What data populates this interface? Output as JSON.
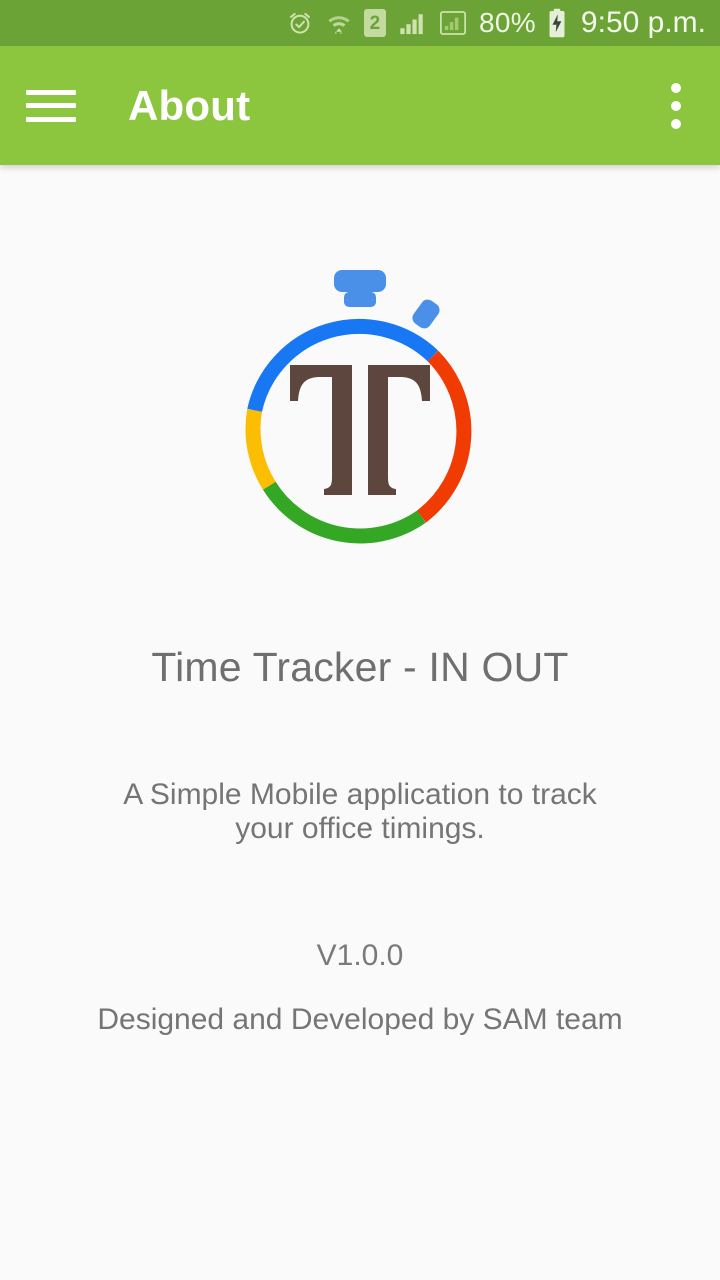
{
  "status_bar": {
    "background_color": "#6CA336",
    "icons": [
      {
        "name": "alarm-clock-icon",
        "label": "alarm"
      },
      {
        "name": "wifi-icon",
        "label": "wifi"
      },
      {
        "name": "sim-2-icon",
        "label": "2"
      },
      {
        "name": "signal-bars-icon",
        "label": "signal"
      },
      {
        "name": "signal-bars-secondary-icon",
        "label": "signal 2"
      },
      {
        "name": "battery-charging-icon",
        "label": "charging"
      }
    ],
    "battery_percent": "80%",
    "time": "9:50 p.m."
  },
  "app_bar": {
    "background_color": "#8CC63F",
    "menu_icon": "hamburger-menu-icon",
    "title": "About",
    "overflow_icon": "more-vertical-icon"
  },
  "logo": {
    "name": "stopwatch-logo",
    "letter": "T",
    "letter_color": "#5C463E",
    "ring_colors": {
      "top": "#1877F2",
      "right": "#F03C02",
      "bottom": "#34A724",
      "left": "#FCBE03"
    },
    "crown_color": "#4A90E8"
  },
  "about": {
    "app_name": "Time Tracker - IN OUT",
    "description": "A Simple Mobile application to track your office timings.",
    "version": "V1.0.0",
    "credit": "Designed and Developed by SAM team"
  },
  "page": {
    "background_color": "#FAFAFA"
  }
}
